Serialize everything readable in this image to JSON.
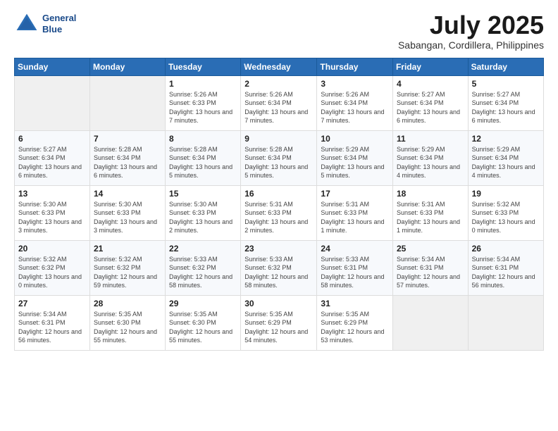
{
  "header": {
    "logo_line1": "General",
    "logo_line2": "Blue",
    "month_title": "July 2025",
    "location": "Sabangan, Cordillera, Philippines"
  },
  "weekdays": [
    "Sunday",
    "Monday",
    "Tuesday",
    "Wednesday",
    "Thursday",
    "Friday",
    "Saturday"
  ],
  "weeks": [
    [
      {
        "day": "",
        "info": ""
      },
      {
        "day": "",
        "info": ""
      },
      {
        "day": "1",
        "info": "Sunrise: 5:26 AM\nSunset: 6:33 PM\nDaylight: 13 hours and 7 minutes."
      },
      {
        "day": "2",
        "info": "Sunrise: 5:26 AM\nSunset: 6:34 PM\nDaylight: 13 hours and 7 minutes."
      },
      {
        "day": "3",
        "info": "Sunrise: 5:26 AM\nSunset: 6:34 PM\nDaylight: 13 hours and 7 minutes."
      },
      {
        "day": "4",
        "info": "Sunrise: 5:27 AM\nSunset: 6:34 PM\nDaylight: 13 hours and 6 minutes."
      },
      {
        "day": "5",
        "info": "Sunrise: 5:27 AM\nSunset: 6:34 PM\nDaylight: 13 hours and 6 minutes."
      }
    ],
    [
      {
        "day": "6",
        "info": "Sunrise: 5:27 AM\nSunset: 6:34 PM\nDaylight: 13 hours and 6 minutes."
      },
      {
        "day": "7",
        "info": "Sunrise: 5:28 AM\nSunset: 6:34 PM\nDaylight: 13 hours and 6 minutes."
      },
      {
        "day": "8",
        "info": "Sunrise: 5:28 AM\nSunset: 6:34 PM\nDaylight: 13 hours and 5 minutes."
      },
      {
        "day": "9",
        "info": "Sunrise: 5:28 AM\nSunset: 6:34 PM\nDaylight: 13 hours and 5 minutes."
      },
      {
        "day": "10",
        "info": "Sunrise: 5:29 AM\nSunset: 6:34 PM\nDaylight: 13 hours and 5 minutes."
      },
      {
        "day": "11",
        "info": "Sunrise: 5:29 AM\nSunset: 6:34 PM\nDaylight: 13 hours and 4 minutes."
      },
      {
        "day": "12",
        "info": "Sunrise: 5:29 AM\nSunset: 6:34 PM\nDaylight: 13 hours and 4 minutes."
      }
    ],
    [
      {
        "day": "13",
        "info": "Sunrise: 5:30 AM\nSunset: 6:33 PM\nDaylight: 13 hours and 3 minutes."
      },
      {
        "day": "14",
        "info": "Sunrise: 5:30 AM\nSunset: 6:33 PM\nDaylight: 13 hours and 3 minutes."
      },
      {
        "day": "15",
        "info": "Sunrise: 5:30 AM\nSunset: 6:33 PM\nDaylight: 13 hours and 2 minutes."
      },
      {
        "day": "16",
        "info": "Sunrise: 5:31 AM\nSunset: 6:33 PM\nDaylight: 13 hours and 2 minutes."
      },
      {
        "day": "17",
        "info": "Sunrise: 5:31 AM\nSunset: 6:33 PM\nDaylight: 13 hours and 1 minute."
      },
      {
        "day": "18",
        "info": "Sunrise: 5:31 AM\nSunset: 6:33 PM\nDaylight: 13 hours and 1 minute."
      },
      {
        "day": "19",
        "info": "Sunrise: 5:32 AM\nSunset: 6:33 PM\nDaylight: 13 hours and 0 minutes."
      }
    ],
    [
      {
        "day": "20",
        "info": "Sunrise: 5:32 AM\nSunset: 6:32 PM\nDaylight: 13 hours and 0 minutes."
      },
      {
        "day": "21",
        "info": "Sunrise: 5:32 AM\nSunset: 6:32 PM\nDaylight: 12 hours and 59 minutes."
      },
      {
        "day": "22",
        "info": "Sunrise: 5:33 AM\nSunset: 6:32 PM\nDaylight: 12 hours and 58 minutes."
      },
      {
        "day": "23",
        "info": "Sunrise: 5:33 AM\nSunset: 6:32 PM\nDaylight: 12 hours and 58 minutes."
      },
      {
        "day": "24",
        "info": "Sunrise: 5:33 AM\nSunset: 6:31 PM\nDaylight: 12 hours and 58 minutes."
      },
      {
        "day": "25",
        "info": "Sunrise: 5:34 AM\nSunset: 6:31 PM\nDaylight: 12 hours and 57 minutes."
      },
      {
        "day": "26",
        "info": "Sunrise: 5:34 AM\nSunset: 6:31 PM\nDaylight: 12 hours and 56 minutes."
      }
    ],
    [
      {
        "day": "27",
        "info": "Sunrise: 5:34 AM\nSunset: 6:31 PM\nDaylight: 12 hours and 56 minutes."
      },
      {
        "day": "28",
        "info": "Sunrise: 5:35 AM\nSunset: 6:30 PM\nDaylight: 12 hours and 55 minutes."
      },
      {
        "day": "29",
        "info": "Sunrise: 5:35 AM\nSunset: 6:30 PM\nDaylight: 12 hours and 55 minutes."
      },
      {
        "day": "30",
        "info": "Sunrise: 5:35 AM\nSunset: 6:29 PM\nDaylight: 12 hours and 54 minutes."
      },
      {
        "day": "31",
        "info": "Sunrise: 5:35 AM\nSunset: 6:29 PM\nDaylight: 12 hours and 53 minutes."
      },
      {
        "day": "",
        "info": ""
      },
      {
        "day": "",
        "info": ""
      }
    ]
  ]
}
